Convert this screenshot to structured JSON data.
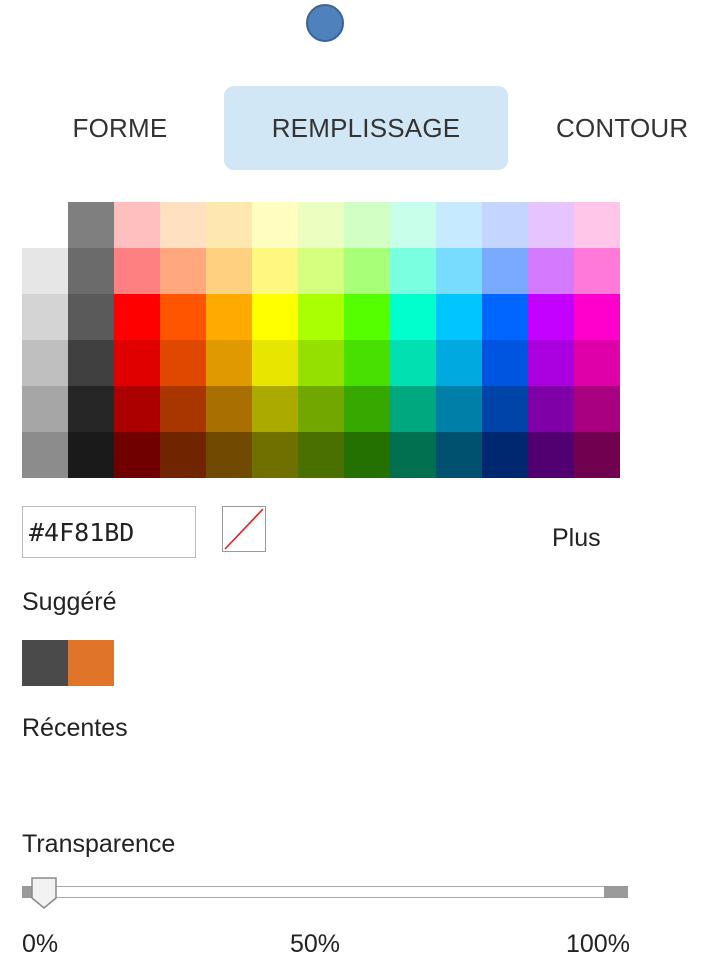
{
  "current_color": "#4F81BD",
  "tabs": [
    {
      "label": "FORME",
      "active": false
    },
    {
      "label": "REMPLISSAGE",
      "active": true
    },
    {
      "label": "CONTOUR",
      "active": false
    }
  ],
  "palette": {
    "rows": [
      [
        "#FFFFFF",
        "#7F7F7F",
        "#FFBFBF",
        "#FFE0C0",
        "#FFE8B0",
        "#FFFDBF",
        "#EAFFC0",
        "#D2FFC4",
        "#C8FFEA",
        "#C6EAFF",
        "#C4D6FF",
        "#E6C4FF",
        "#FFC6EA"
      ],
      [
        "#E6E6E6",
        "#6B6B6B",
        "#FF8080",
        "#FFA880",
        "#FFD080",
        "#FFF880",
        "#D6FF80",
        "#A8FF78",
        "#7AFFE0",
        "#78DCFF",
        "#7AAAFF",
        "#D47AFF",
        "#FF7AD8"
      ],
      [
        "#D4D4D4",
        "#5A5A5A",
        "#FF0000",
        "#FF5500",
        "#FFAA00",
        "#FFFF00",
        "#AAFF00",
        "#55FF00",
        "#00FFCC",
        "#00C6FF",
        "#0066FF",
        "#C400FF",
        "#FF00CC"
      ],
      [
        "#BFBFBF",
        "#404040",
        "#E00000",
        "#E04800",
        "#E09A00",
        "#E6E600",
        "#96E000",
        "#48E000",
        "#00E0B0",
        "#00AAE0",
        "#0055E0",
        "#AA00E0",
        "#E000AA"
      ],
      [
        "#A6A6A6",
        "#262626",
        "#AA0000",
        "#A83600",
        "#A87000",
        "#AAAA00",
        "#70A800",
        "#36A800",
        "#00A880",
        "#0080A8",
        "#0044A8",
        "#8000A8",
        "#A80080"
      ],
      [
        "#8C8C8C",
        "#1A1A1A",
        "#700000",
        "#702400",
        "#704A00",
        "#707000",
        "#4A7000",
        "#247000",
        "#007050",
        "#005070",
        "#002870",
        "#500070",
        "#700050"
      ]
    ]
  },
  "hex_value": "#4F81BD",
  "no_fill_icon": "no-color-slash-icon",
  "more_label": "Plus",
  "suggested_label": "Suggéré",
  "suggested_colors": [
    "#4A4A4A",
    "#E07428"
  ],
  "recent_label": "Récentes",
  "transparency": {
    "label": "Transparence",
    "value_percent": 0,
    "ticks": [
      "0%",
      "50%",
      "100%"
    ]
  }
}
